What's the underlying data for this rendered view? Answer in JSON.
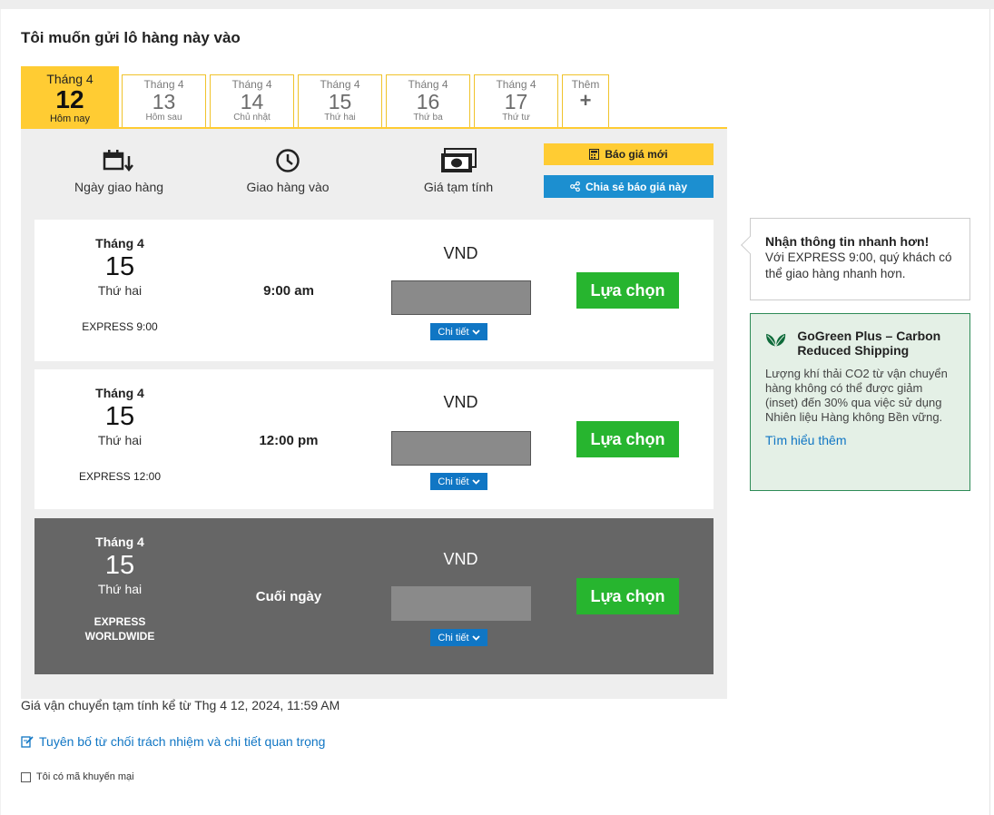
{
  "heading": "Tôi muốn gửi lô hàng này vào",
  "tabs": [
    {
      "month": "Tháng 4",
      "day": "12",
      "weekday": "Hôm nay"
    },
    {
      "month": "Tháng 4",
      "day": "13",
      "weekday": "Hôm sau"
    },
    {
      "month": "Tháng 4",
      "day": "14",
      "weekday": "Chủ nhật"
    },
    {
      "month": "Tháng 4",
      "day": "15",
      "weekday": "Thứ hai"
    },
    {
      "month": "Tháng 4",
      "day": "16",
      "weekday": "Thứ ba"
    },
    {
      "month": "Tháng 4",
      "day": "17",
      "weekday": "Thứ tư"
    }
  ],
  "more_tab": {
    "label": "Thêm",
    "plus": "+"
  },
  "columns": {
    "delivery_date": "Ngày giao hàng",
    "delivery_time": "Giao hàng vào",
    "estimated_price": "Giá tạm tính"
  },
  "buttons": {
    "new_quote": "Báo giá mới",
    "share_quote": "Chia sẻ báo giá này"
  },
  "options": [
    {
      "month": "Tháng 4",
      "day": "15",
      "weekday": "Thứ hai",
      "service": "EXPRESS 9:00",
      "time": "9:00 am",
      "currency": "VND",
      "detail": "Chi tiết",
      "choose": "Lựa chọn"
    },
    {
      "month": "Tháng 4",
      "day": "15",
      "weekday": "Thứ hai",
      "service": "EXPRESS 12:00",
      "time": "12:00 pm",
      "currency": "VND",
      "detail": "Chi tiết",
      "choose": "Lựa chọn"
    },
    {
      "month": "Tháng 4",
      "day": "15",
      "weekday": "Thứ hai",
      "service": "EXPRESS WORLDWIDE",
      "time": "Cuối ngày",
      "currency": "VND",
      "detail": "Chi tiết",
      "choose": "Lựa chọn"
    }
  ],
  "footer": {
    "note": "Giá vận chuyển tạm tính kể từ Thg 4 12, 2024, 11:59 AM",
    "disclaimer": "Tuyên bố từ chối trách nhiệm và chi tiết quan trọng",
    "promo": "Tôi có mã khuyến mại"
  },
  "info": {
    "title": "Nhận thông tin nhanh hơn!",
    "body": "Với EXPRESS 9:00, quý khách có thể giao hàng nhanh hơn."
  },
  "gogreen": {
    "title": "GoGreen Plus – Carbon Reduced Shipping",
    "body": "Lượng khí thải CO2 từ vận chuyển hàng không có thể được giảm (inset) đến 30% qua việc sử dụng Nhiên liệu Hàng không Bền vững.",
    "link": "Tìm hiểu thêm"
  },
  "colors": {
    "accent": "#ffcc33",
    "choose": "#27b52f",
    "link": "#1076c4",
    "selected_row": "#666666"
  }
}
